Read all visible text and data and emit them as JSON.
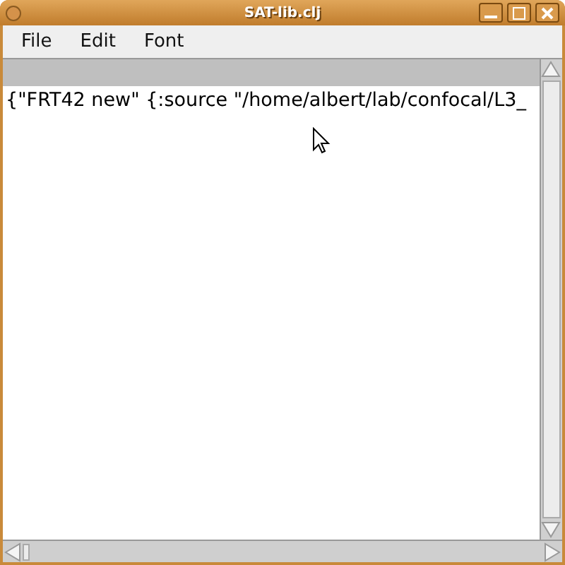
{
  "window": {
    "title": "SAT-lib.clj"
  },
  "menu": [
    "File",
    "Edit",
    "Font"
  ],
  "editor": {
    "text": "{\"FRT42 new\" {:source \"/home/albert/lab/confocal/L3_"
  }
}
